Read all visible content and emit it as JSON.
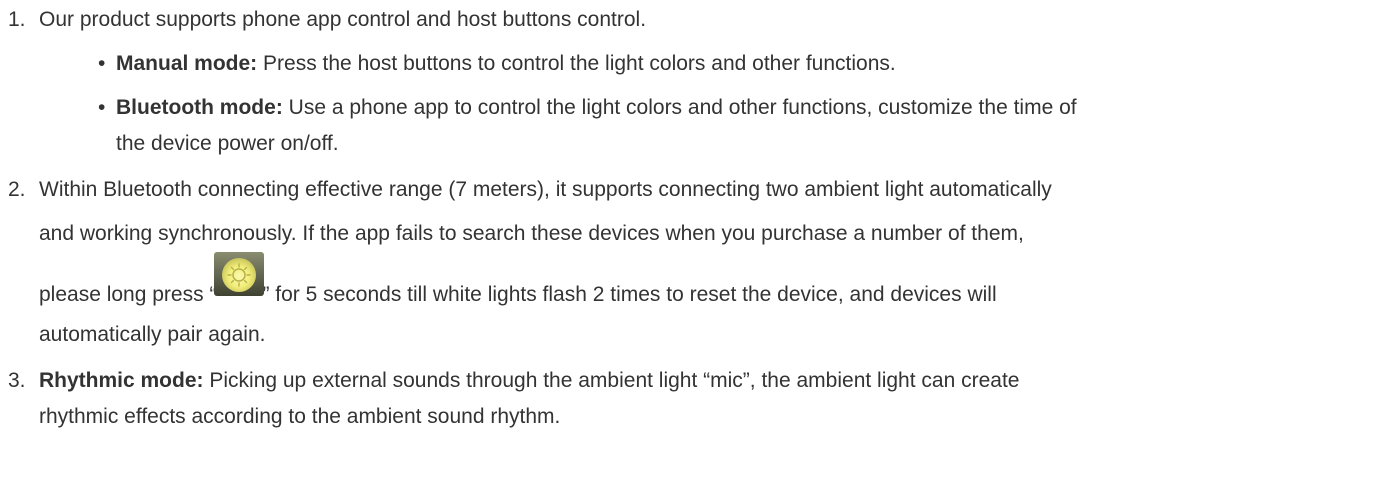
{
  "items": [
    {
      "number": "1.",
      "text": "Our product supports phone app control and host buttons control.",
      "subitems": [
        {
          "bullet": "•",
          "label": "Manual mode:",
          "text": " Press the host buttons to control the light colors and other functions."
        },
        {
          "bullet": "•",
          "label": "Bluetooth mode:",
          "text": " Use a phone app to control the light colors and other functions, customize the time of",
          "text_cont": "the device power on/off."
        }
      ]
    },
    {
      "number": "2.",
      "line1": "Within Bluetooth connecting effective range (7 meters), it supports connecting two ambient light automatically",
      "line2": "and working synchronously. If the app fails to search these devices when you purchase a number of them,",
      "line3_before": "please long press “",
      "line3_icon": "light-button-icon",
      "line3_after": "” for 5 seconds till white lights flash 2 times to reset the device, and devices will",
      "line4": "automatically pair again."
    },
    {
      "number": "3.",
      "label": "Rhythmic mode:",
      "text": " Picking up external sounds through the ambient light “mic”, the ambient light can create",
      "text_cont": "rhythmic effects according to the ambient sound rhythm."
    }
  ],
  "colors": {
    "text": "#333333",
    "icon_yellow": "#f2ee7a",
    "icon_bg": "#5b5f47"
  }
}
